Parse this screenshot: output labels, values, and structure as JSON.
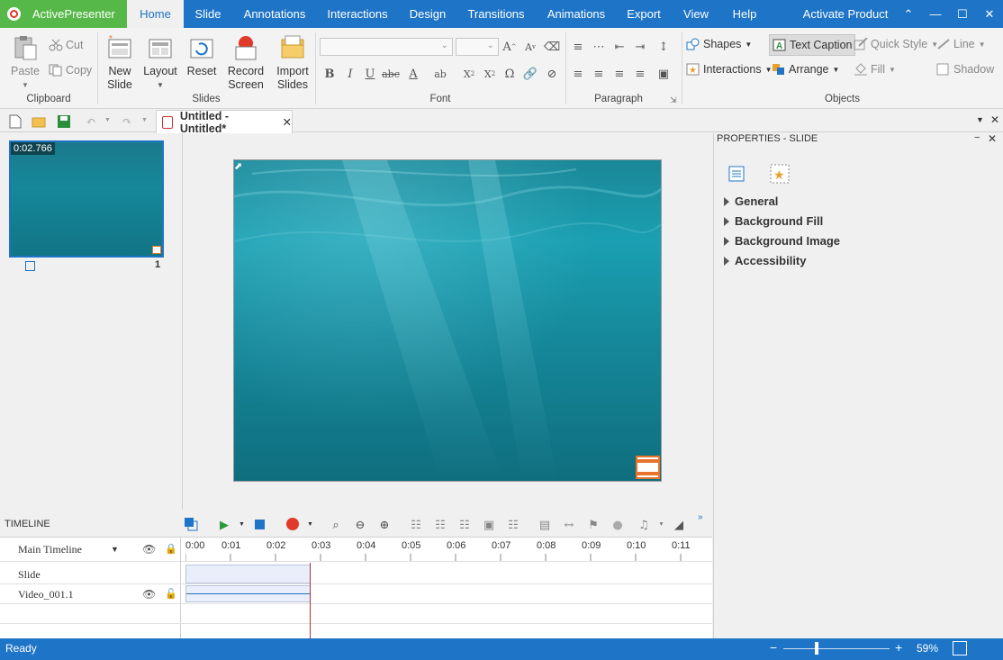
{
  "app": {
    "name": "ActivePresenter"
  },
  "menu": {
    "items": [
      "Home",
      "Slide",
      "Annotations",
      "Interactions",
      "Design",
      "Transitions",
      "Animations",
      "Export",
      "View",
      "Help"
    ],
    "activate": "Activate Product"
  },
  "ribbon": {
    "clipboard": {
      "paste": "Paste",
      "cut": "Cut",
      "copy": "Copy",
      "label": "Clipboard"
    },
    "slides": {
      "new_slide": "New Slide",
      "layout": "Layout",
      "reset": "Reset",
      "record_screen": "Record Screen",
      "import_slides": "Import Slides",
      "label": "Slides"
    },
    "font": {
      "label": "Font"
    },
    "paragraph": {
      "label": "Paragraph"
    },
    "objects": {
      "shapes": "Shapes",
      "text_caption": "Text Caption",
      "quick_style": "Quick Style",
      "line": "Line",
      "interactions": "Interactions",
      "arrange": "Arrange",
      "fill": "Fill",
      "shadow": "Shadow",
      "label": "Objects"
    }
  },
  "doc": {
    "tab_title": "Untitled - Untitled*"
  },
  "slide_panel": {
    "duration": "0:02.766",
    "number": "1"
  },
  "properties": {
    "title": "PROPERTIES - SLIDE",
    "sections": [
      "General",
      "Background Fill",
      "Background Image",
      "Accessibility"
    ]
  },
  "timeline": {
    "title": "TIMELINE",
    "main": "Main Timeline",
    "ticks": [
      "0:00",
      "0:01",
      "0:02",
      "0:03",
      "0:04",
      "0:05",
      "0:06",
      "0:07",
      "0:08",
      "0:09",
      "0:10",
      "0:11"
    ],
    "rows": [
      "Slide",
      "Video_001.1"
    ]
  },
  "status": {
    "text": "Ready",
    "zoom": "59%",
    "zoom_level": 0.59
  },
  "colors": {
    "accent": "#1e74c6",
    "app_green": "#56b848",
    "slide_teal": "#1a8797"
  }
}
